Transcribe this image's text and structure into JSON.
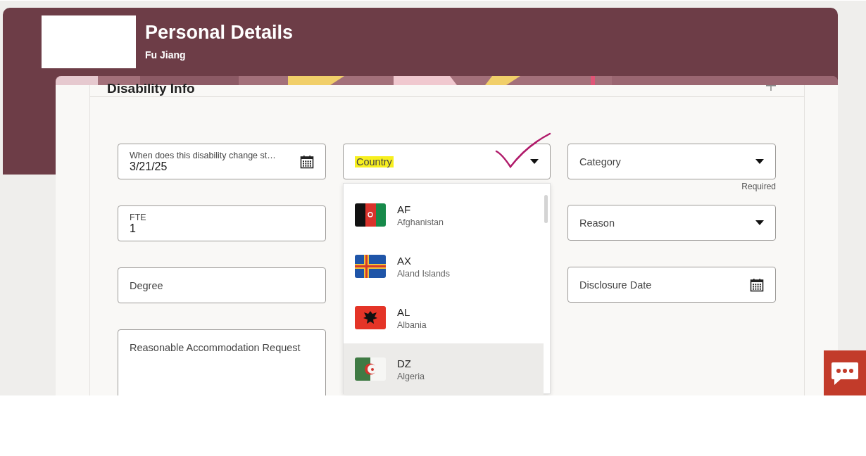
{
  "header": {
    "title": "Personal Details",
    "subtitle": "Fu Jiang"
  },
  "section": {
    "title": "Disability Info"
  },
  "columns": [
    [
      {
        "kind": "date",
        "label": "When does this disability change st…",
        "value": "3/21/25"
      },
      {
        "kind": "text",
        "label": "FTE",
        "value": "1"
      },
      {
        "kind": "text",
        "label": "Degree"
      },
      {
        "kind": "textarea",
        "label": "Reasonable Accommodation Request"
      }
    ],
    [
      {
        "kind": "select",
        "label": "Country",
        "highlighted": true,
        "expanded": true
      }
    ],
    [
      {
        "kind": "select",
        "label": "Category",
        "helper": "Required"
      },
      {
        "kind": "select",
        "label": "Reason"
      },
      {
        "kind": "date",
        "label": "Disclosure Date"
      }
    ]
  ],
  "country_options": [
    {
      "kind": "tricolor",
      "code": "AF",
      "name": "Afghanistan",
      "highlighted": false
    },
    {
      "kind": "cross",
      "code": "AX",
      "name": "Aland Islands",
      "highlighted": false
    },
    {
      "kind": "eagle",
      "code": "AL",
      "name": "Albania",
      "highlighted": false
    },
    {
      "kind": "crescent",
      "code": "DZ",
      "name": "Algeria",
      "highlighted": true
    }
  ]
}
